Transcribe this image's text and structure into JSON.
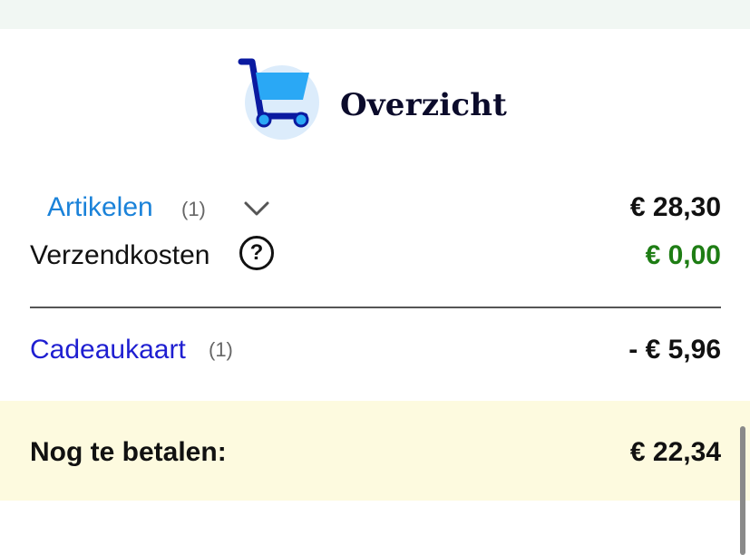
{
  "header": {
    "title": "Overzicht",
    "icon": "shopping-cart-icon"
  },
  "summary": {
    "articles": {
      "label": "Artikelen",
      "count": "(1)",
      "amount": "€ 28,30"
    },
    "shipping": {
      "label": "Verzendkosten",
      "help": "?",
      "amount": "€ 0,00"
    },
    "giftcard": {
      "label": "Cadeaukaart",
      "count": "(1)",
      "amount": "- € 5,96"
    }
  },
  "total": {
    "label": "Nog te betalen:",
    "amount": "€ 22,34"
  },
  "colors": {
    "link_blue": "#1a82d9",
    "gift_link": "#1f1fd1",
    "free_green": "#1e7d14",
    "total_band": "#fdfadf",
    "cart_icon_dark": "#0a1aa0",
    "cart_icon_light": "#2aa8f5"
  }
}
